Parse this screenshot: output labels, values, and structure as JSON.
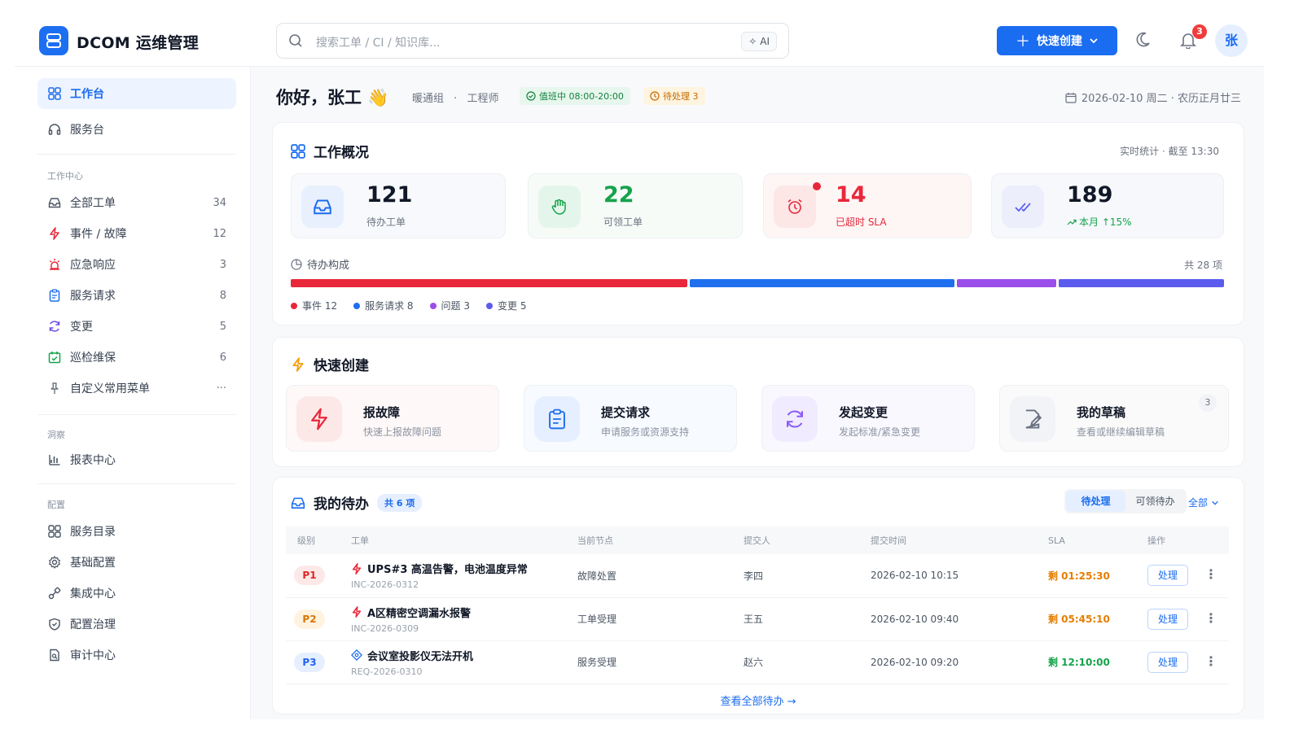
{
  "header": {
    "brand": "DCOM 运维管理",
    "search_placeholder": "搜索工单 / CI / 知识库...",
    "ai_label": "AI",
    "quick_create_label": "快速创建",
    "notification_count": "3",
    "avatar_text": "张"
  },
  "sidebar": {
    "top_items": [
      {
        "label": "工作台",
        "active": true
      },
      {
        "label": "服务台"
      }
    ],
    "section_work": "工作中心",
    "work_items": [
      {
        "label": "全部工单",
        "count": "34"
      },
      {
        "label": "事件 / 故障",
        "count": "12"
      },
      {
        "label": "应急响应",
        "count": "3"
      },
      {
        "label": "服务请求",
        "count": "8"
      },
      {
        "label": "变更",
        "count": "5"
      },
      {
        "label": "巡检维保",
        "count": "6"
      },
      {
        "label": "自定义常用菜单",
        "count": "···"
      }
    ],
    "section_insight": "洞察",
    "insight_items": [
      {
        "label": "报表中心"
      }
    ],
    "section_config": "配置",
    "config_items": [
      {
        "label": "服务目录"
      },
      {
        "label": "基础配置"
      },
      {
        "label": "集成中心"
      },
      {
        "label": "配置治理"
      },
      {
        "label": "审计中心"
      }
    ]
  },
  "greeting": {
    "title": "你好，张工 👋",
    "team": "暖通组",
    "dot": "·",
    "role": "工程师",
    "on_duty": "值班中 08:00-20:00",
    "pending": "待处理 3",
    "date": "2026-02-10 周二 · 农历正月廿三"
  },
  "overview": {
    "title": "工作概况",
    "updated": "实时统计 · 截至 13:30",
    "stats": [
      {
        "value": "121",
        "label": "待办工单"
      },
      {
        "value": "22",
        "label": "可领工单"
      },
      {
        "value": "14",
        "label": "已超时 SLA"
      },
      {
        "value": "189",
        "label": "本月 ↑15%"
      }
    ],
    "composition_title": "待办构成",
    "composition_total": "共 28 项",
    "composition": [
      {
        "label": "事件 12",
        "value": 12,
        "color": "#e8283a"
      },
      {
        "label": "服务请求 8",
        "value": 8,
        "color": "#1f6fef"
      },
      {
        "label": "问题 3",
        "value": 3,
        "color": "#9b4dea"
      },
      {
        "label": "变更 5",
        "value": 5,
        "color": "#5b5bee"
      }
    ]
  },
  "quick": {
    "title": "快速创建",
    "items": [
      {
        "title": "报故障",
        "subtitle": "快速上报故障问题"
      },
      {
        "title": "提交请求",
        "subtitle": "申请服务或资源支持"
      },
      {
        "title": "发起变更",
        "subtitle": "发起标准/紧急变更"
      },
      {
        "title": "我的草稿",
        "subtitle": "查看或继续编辑草稿",
        "count": "3"
      }
    ]
  },
  "todo": {
    "title": "我的待办",
    "total": "共 6 项",
    "tab_pending": "待处理",
    "tab_claimable": "可领待办",
    "filter": "全部",
    "columns": [
      "级别",
      "工单",
      "当前节点",
      "提交人",
      "提交时间",
      "SLA",
      "操作"
    ],
    "rows": [
      {
        "priority": "P1",
        "title": "UPS#3 高温告警，电池温度异常",
        "id": "INC-2026-0312",
        "node": "故障处置",
        "submitter": "李四",
        "time": "2026-02-10 10:15",
        "sla": "剩 01:25:30",
        "sla_color": "#e67e00",
        "action": "处理"
      },
      {
        "priority": "P2",
        "title": "A区精密空调漏水报警",
        "id": "INC-2026-0309",
        "node": "工单受理",
        "submitter": "王五",
        "time": "2026-02-10 09:40",
        "sla": "剩 05:45:10",
        "sla_color": "#e67e00",
        "action": "处理"
      },
      {
        "priority": "P3",
        "title": "会议室投影仪无法开机",
        "id": "REQ-2026-0310",
        "node": "服务受理",
        "submitter": "赵六",
        "time": "2026-02-10 09:20",
        "sla": "剩 12:10:00",
        "sla_color": "#16a34a",
        "action": "处理"
      }
    ],
    "view_all": "查看全部待办 →"
  }
}
